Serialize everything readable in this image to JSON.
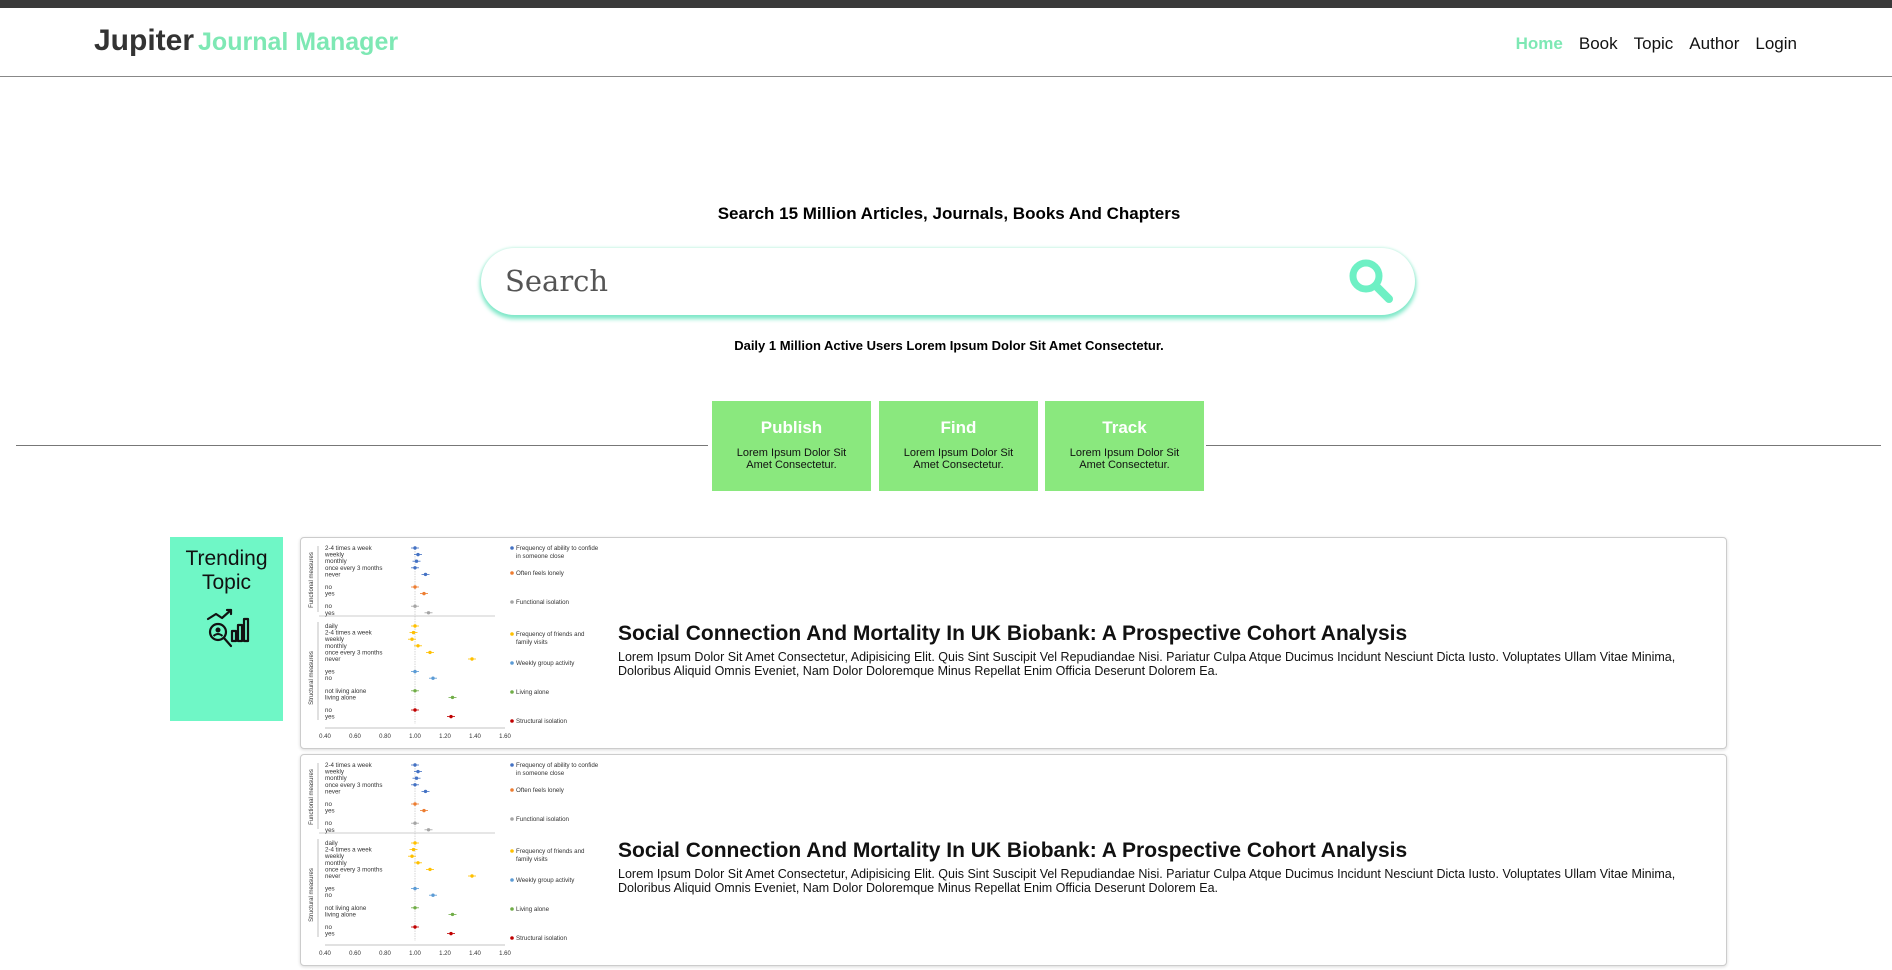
{
  "brand": {
    "name": "Jupiter",
    "subtitle": "Journal Manager"
  },
  "nav": {
    "items": [
      {
        "label": "Home",
        "active": true
      },
      {
        "label": "Book",
        "active": false
      },
      {
        "label": "Topic",
        "active": false
      },
      {
        "label": "Author",
        "active": false
      },
      {
        "label": "Login",
        "active": false
      }
    ]
  },
  "hero": {
    "title": "Search 15 Million Articles, Journals, Books And Chapters",
    "search_placeholder": "Search",
    "search_icon": "search-icon",
    "subtitle": "Daily 1 Million Active Users Lorem Ipsum Dolor Sit Amet Consectetur."
  },
  "features": [
    {
      "title": "Publish",
      "description": "Lorem Ipsum Dolor Sit Amet Consectetur."
    },
    {
      "title": "Find",
      "description": "Lorem Ipsum Dolor Sit Amet Consectetur."
    },
    {
      "title": "Track",
      "description": "Lorem Ipsum Dolor Sit Amet Consectetur."
    }
  ],
  "trending": {
    "label": "Trending Topic",
    "icon": "analytics-icon"
  },
  "articles": [
    {
      "title": "Social Connection And Mortality In UK Biobank: A Prospective Cohort Analysis",
      "body": "Lorem Ipsum Dolor Sit Amet Consectetur, Adipisicing Elit. Quis Sint Suscipit Vel Repudiandae Nisi. Pariatur Culpa Atque Ducimus Incidunt Nesciunt Dicta Iusto. Voluptates Ullam Vitae Minima, Doloribus Aliquid Omnis Eveniet, Nam Dolor Doloremque Minus Repellat Enim Officia Deserunt Dolorem Ea."
    },
    {
      "title": "Social Connection And Mortality In UK Biobank: A Prospective Cohort Analysis",
      "body": "Lorem Ipsum Dolor Sit Amet Consectetur, Adipisicing Elit. Quis Sint Suscipit Vel Repudiandae Nisi. Pariatur Culpa Atque Ducimus Incidunt Nesciunt Dicta Iusto. Voluptates Ullam Vitae Minima, Doloribus Aliquid Omnis Eveniet, Nam Dolor Doloremque Minus Repellat Enim Officia Deserunt Dolorem Ea."
    }
  ],
  "thumbnail_chart": {
    "group_labels": [
      "Functional measures",
      "Structural measures"
    ],
    "row_labels": [
      [
        "2-4 times a week",
        "weekly",
        "monthly",
        "once every 3 months",
        "never",
        "no",
        "yes",
        "no",
        "yes"
      ],
      [
        "daily",
        "2-4 times a week",
        "weekly",
        "monthly",
        "once every 3 months",
        "never",
        "yes",
        "no",
        "not living alone",
        "living alone",
        "no",
        "yes"
      ]
    ],
    "legend": [
      {
        "label": "Frequency of ability to confide in someone close",
        "color": "#4472c4"
      },
      {
        "label": "Often feels lonely",
        "color": "#ed7d31"
      },
      {
        "label": "Functional isolation",
        "color": "#a5a5a5"
      },
      {
        "label": "Frequency of friends and family visits",
        "color": "#ffc000"
      },
      {
        "label": "Weekly group activity",
        "color": "#5b9bd5"
      },
      {
        "label": "Living alone",
        "color": "#70ad47"
      },
      {
        "label": "Structural isolation",
        "color": "#c00000"
      }
    ],
    "x_ticks": [
      "0.40",
      "0.60",
      "0.80",
      "1.00",
      "1.20",
      "1.40",
      "1.60"
    ]
  }
}
